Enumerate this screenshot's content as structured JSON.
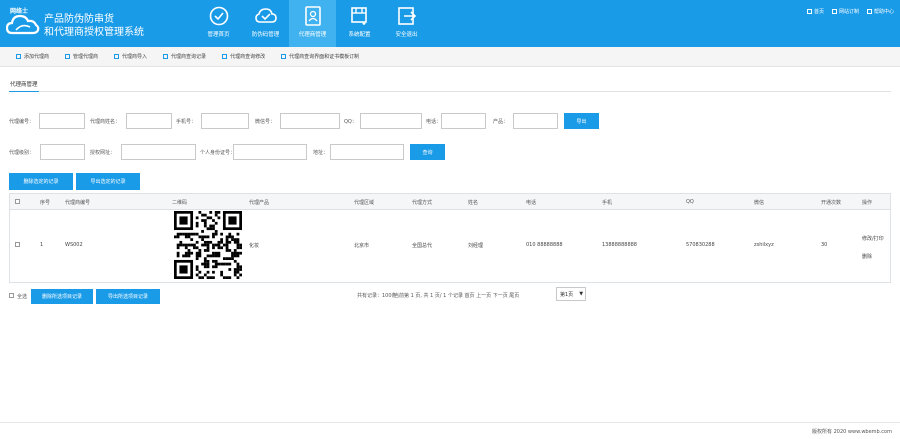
{
  "header": {
    "logo_text": "网络士",
    "brand_line1": "产品防伪防串货",
    "brand_line2": "和代理商授权管理系统",
    "nav": [
      {
        "label": "管理首页",
        "icon": "check-circle-icon",
        "active": false
      },
      {
        "label": "防伪码管理",
        "icon": "cloud-check-icon",
        "active": false
      },
      {
        "label": "代理商管理",
        "icon": "document-user-icon",
        "active": true
      },
      {
        "label": "系统配置",
        "icon": "settings-window-icon",
        "active": false
      },
      {
        "label": "安全退出",
        "icon": "logout-icon",
        "active": false
      }
    ],
    "toplinks": [
      "首页",
      "网站订制",
      "帮助中心"
    ]
  },
  "subnav": [
    "添加代理商",
    "管理代理商",
    "代理商导入",
    "代理商查询记录",
    "代理商查询修改",
    "代理商查询界面和证书模板订制"
  ],
  "tab": "代理商管理",
  "filters": {
    "row1": [
      "代理编号：",
      "代理商姓名：",
      "手机号：",
      "微信号：",
      "QQ：",
      "电话：",
      "产品："
    ],
    "row2": [
      "代理级别：",
      "授权网址：",
      "个人身份证号：",
      "地址："
    ],
    "import_button": "导出",
    "search_button": "查询"
  },
  "actions": {
    "delete_selected": "删除选定的记录",
    "export_selected": "导出选定的记录"
  },
  "table": {
    "headers": [
      "",
      "序号",
      "代理商编号",
      "二维码",
      "代理产品",
      "代理区域",
      "代理方式",
      "姓名",
      "电话",
      "手机",
      "QQ",
      "微信",
      "开通次数",
      "操作"
    ],
    "rows": [
      {
        "index": "1",
        "agent_id": "WS002",
        "product": "化妆",
        "region": "北京市",
        "method": "全国总代",
        "name": "刘经理",
        "phone": "010 88888888",
        "mobile": "13888888888",
        "qq": "570830288",
        "wechat": "zshilxyz",
        "count": "30",
        "ops_line1": "修改/打印",
        "ops_line2": "删除"
      }
    ]
  },
  "bottom": {
    "select_all": "全选",
    "delete_btn": "删除所选项目记录",
    "export_btn": "导出所选项目记录",
    "total": "共有记录：100条",
    "pager_text": "当前第 1 页, 共 1 页/ 1 个记录  首页 上一页  下一页 尾页",
    "page_select": "第1页"
  },
  "copyright": "版权所有 2020 www.wbemb.com"
}
